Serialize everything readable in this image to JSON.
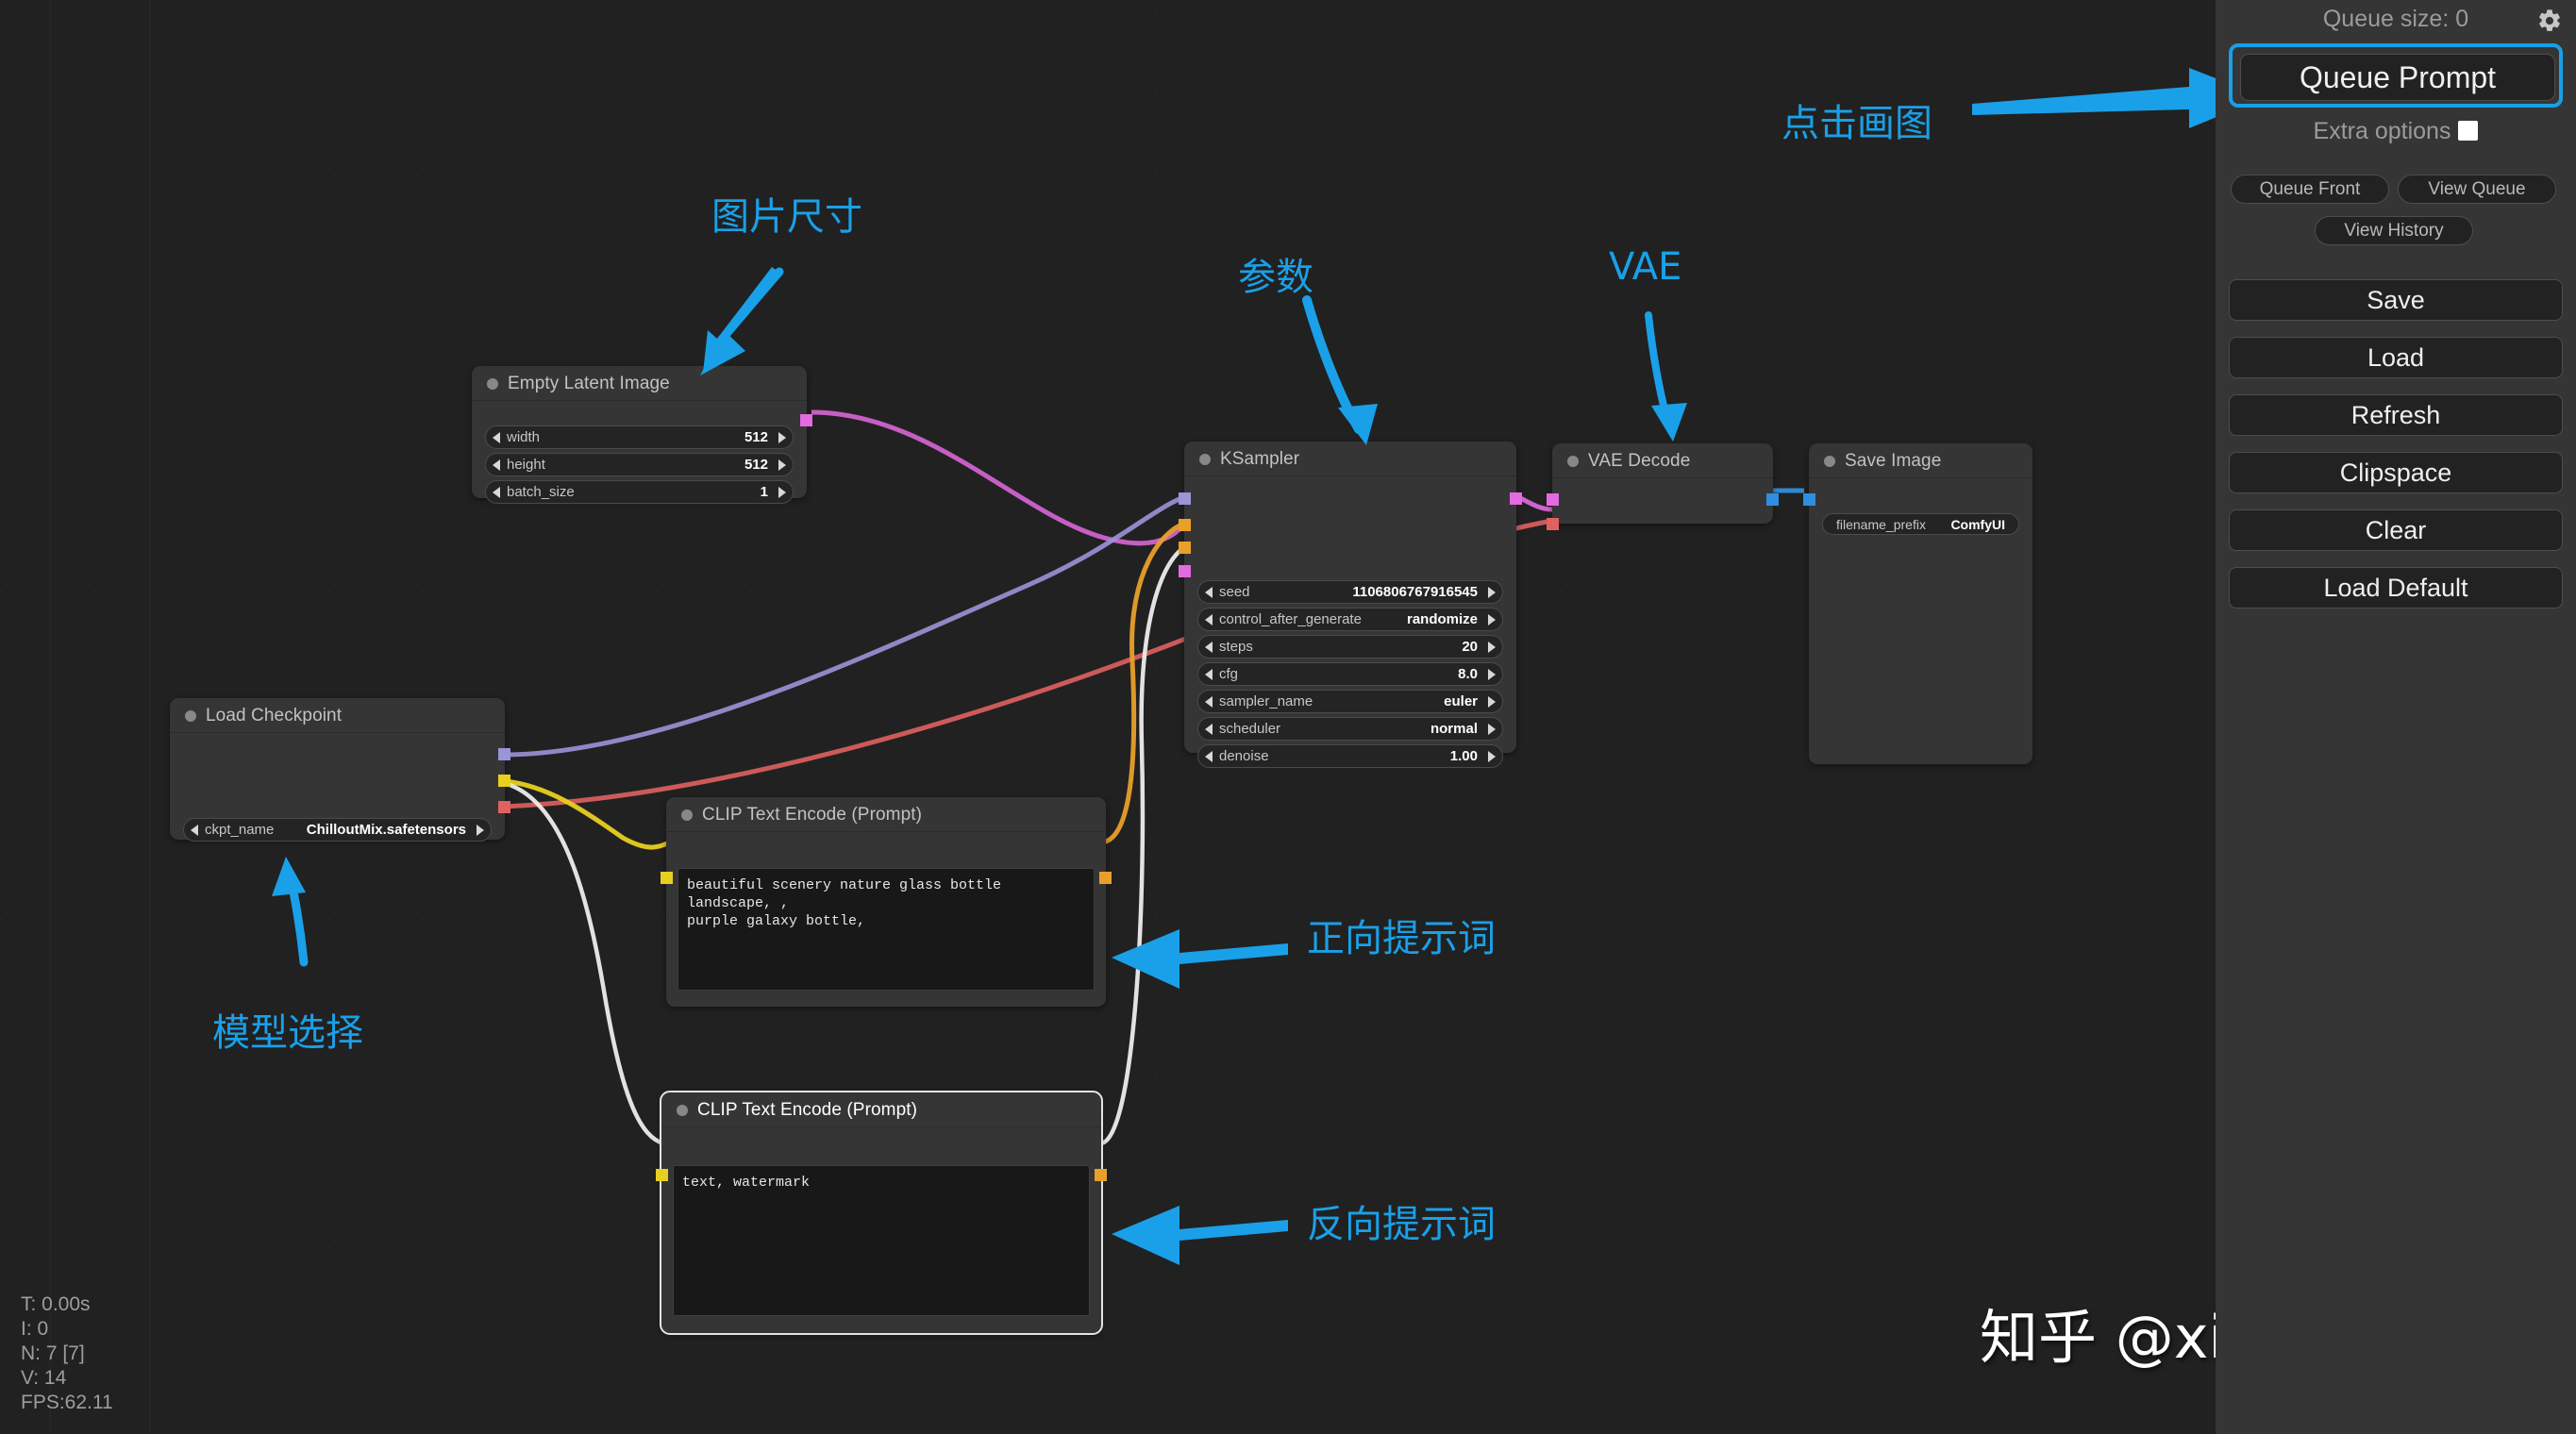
{
  "app": {
    "background_color": "#212121",
    "accent_color": "#1aa0e8",
    "panel_color": "#353535"
  },
  "menu": {
    "queue_size": "Queue size: 0",
    "gear_icon": "gear-icon",
    "queue_prompt": "Queue Prompt",
    "extra_options": "Extra options",
    "queue_front": "Queue Front",
    "view_queue": "View Queue",
    "view_history": "View History",
    "buttons": [
      {
        "label": "Save"
      },
      {
        "label": "Load"
      },
      {
        "label": "Refresh"
      },
      {
        "label": "Clipspace"
      },
      {
        "label": "Clear"
      },
      {
        "label": "Load Default"
      }
    ]
  },
  "nodes": {
    "empty_latent": {
      "title": "Empty Latent Image",
      "widgets": [
        {
          "label": "width",
          "value": "512"
        },
        {
          "label": "height",
          "value": "512"
        },
        {
          "label": "batch_size",
          "value": "1"
        }
      ]
    },
    "load_checkpoint": {
      "title": "Load Checkpoint",
      "widgets": [
        {
          "label": "ckpt_name",
          "value": "ChilloutMix.safetensors"
        }
      ]
    },
    "ksampler": {
      "title": "KSampler",
      "widgets": [
        {
          "label": "seed",
          "value": "1106806767916545"
        },
        {
          "label": "control_after_generate",
          "value": "randomize"
        },
        {
          "label": "steps",
          "value": "20"
        },
        {
          "label": "cfg",
          "value": "8.0"
        },
        {
          "label": "sampler_name",
          "value": "euler"
        },
        {
          "label": "scheduler",
          "value": "normal"
        },
        {
          "label": "denoise",
          "value": "1.00"
        }
      ]
    },
    "clip_positive": {
      "title": "CLIP Text Encode (Prompt)",
      "text": "beautiful scenery nature glass bottle landscape, ,\npurple galaxy bottle,"
    },
    "clip_negative": {
      "title": "CLIP Text Encode (Prompt)",
      "text": "text, watermark"
    },
    "vae_decode": {
      "title": "VAE Decode"
    },
    "save_image": {
      "title": "Save Image",
      "widgets": [
        {
          "label": "filename_prefix",
          "value": "ComfyUI"
        }
      ]
    }
  },
  "annotations": {
    "click_to_draw": "点击画图",
    "image_size": "图片尺寸",
    "parameters": "参数",
    "vae": "VAE",
    "model_select": "模型选择",
    "positive_prompt": "正向提示词",
    "negative_prompt": "反向提示词"
  },
  "stats": {
    "time": "T: 0.00s",
    "iterations": "I: 0",
    "nodes": "N: 7 [7]",
    "version": "V: 14",
    "fps": "FPS:62.11"
  },
  "watermark": "知乎 @xiaobai"
}
